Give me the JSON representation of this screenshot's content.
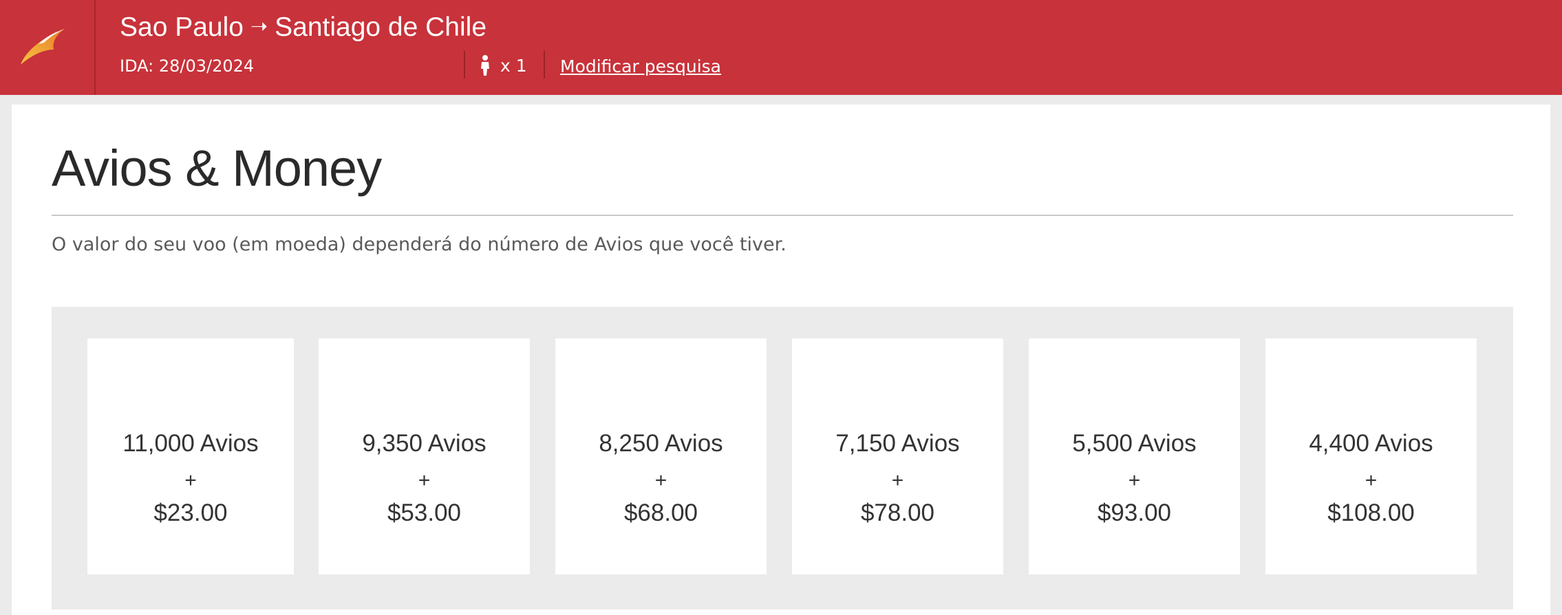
{
  "header": {
    "logo_icon": "iberia-wing-logo-icon",
    "origin": "Sao Paulo",
    "arrow": "➝",
    "destination": "Santiago de Chile",
    "date_label": "IDA: 28/03/2024",
    "passenger_icon": "person-icon",
    "passenger_count": "x 1",
    "modify_link": "Modificar pesquisa"
  },
  "main": {
    "title": "Avios & Money",
    "description": "O valor do seu voo (em moeda) dependerá do número de Avios que você tiver.",
    "options": [
      {
        "avios": "11,000 Avios",
        "plus": "+",
        "price": "$23.00"
      },
      {
        "avios": "9,350 Avios",
        "plus": "+",
        "price": "$53.00"
      },
      {
        "avios": "8,250 Avios",
        "plus": "+",
        "price": "$68.00"
      },
      {
        "avios": "7,150 Avios",
        "plus": "+",
        "price": "$78.00"
      },
      {
        "avios": "5,500 Avios",
        "plus": "+",
        "price": "$93.00"
      },
      {
        "avios": "4,400 Avios",
        "plus": "+",
        "price": "$108.00"
      }
    ]
  },
  "colors": {
    "header_red": "#c8323a",
    "page_background": "#ebebeb",
    "card_background": "#ffffff",
    "logo_gradient_start": "#f7c640",
    "logo_gradient_end": "#e8792a"
  }
}
